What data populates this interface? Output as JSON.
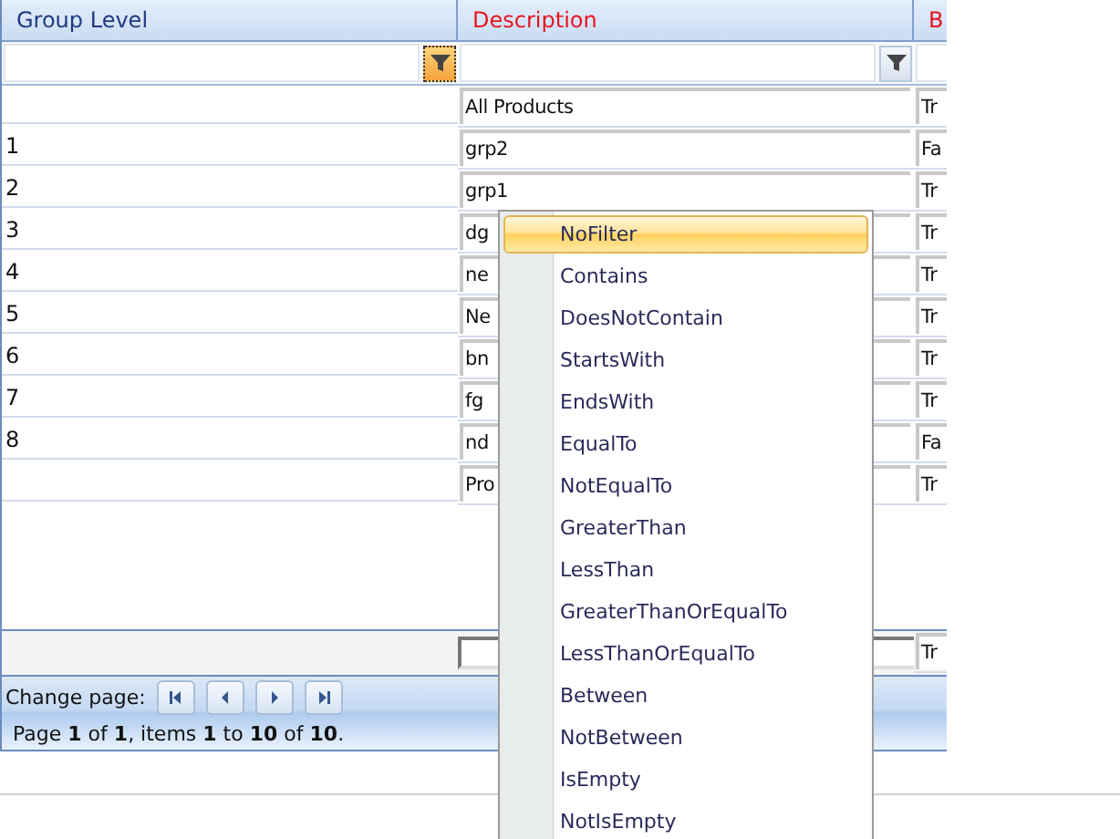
{
  "grid": {
    "columns": [
      {
        "label": "Group Level",
        "highlighted": false
      },
      {
        "label": "Description",
        "highlighted": true
      },
      {
        "label": "B",
        "highlighted": true
      }
    ],
    "filters": [
      {
        "active": true
      },
      {
        "active": false
      }
    ],
    "rows": [
      {
        "description": "All Products",
        "column_3": "Tr"
      },
      {
        "level": "1",
        "description": "grp2",
        "column_3": "Fa"
      },
      {
        "level": "2",
        "description": "grp1",
        "column_3": "Tr"
      },
      {
        "level": "3",
        "description": "dg",
        "column_3": "Tr"
      },
      {
        "level": "4",
        "description": "ne",
        "column_3": "Tr"
      },
      {
        "level": "5",
        "description": "Ne",
        "column_3": "Tr"
      },
      {
        "level": "6",
        "description": "bn",
        "column_3": "Tr"
      },
      {
        "level": "7",
        "description": "fg",
        "column_3": "Tr"
      },
      {
        "level": "8",
        "description": "nd",
        "column_3": "Fa"
      },
      {
        "description": "Pro",
        "column_3": "Tr"
      }
    ],
    "footer": {
      "column_3": "Tr"
    },
    "pager": {
      "label": "Change page:",
      "summary": "Page **1** of **1**, items **1** to **10** of **10**."
    }
  },
  "filter_menu": {
    "items": [
      {
        "label": "NoFilter",
        "selected": true
      },
      {
        "label": "Contains",
        "selected": false
      },
      {
        "label": "DoesNotContain",
        "selected": false
      },
      {
        "label": "StartsWith",
        "selected": false
      },
      {
        "label": "EndsWith",
        "selected": false
      },
      {
        "label": "EqualTo",
        "selected": false
      },
      {
        "label": "NotEqualTo",
        "selected": false
      },
      {
        "label": "GreaterThan",
        "selected": false
      },
      {
        "label": "LessThan",
        "selected": false
      },
      {
        "label": "GreaterThanOrEqualTo",
        "selected": false
      },
      {
        "label": "LessThanOrEqualTo",
        "selected": false
      },
      {
        "label": "Between",
        "selected": false
      },
      {
        "label": "NotBetween",
        "selected": false
      },
      {
        "label": "IsEmpty",
        "selected": false
      },
      {
        "label": "NotIsEmpty",
        "selected": false
      }
    ]
  }
}
